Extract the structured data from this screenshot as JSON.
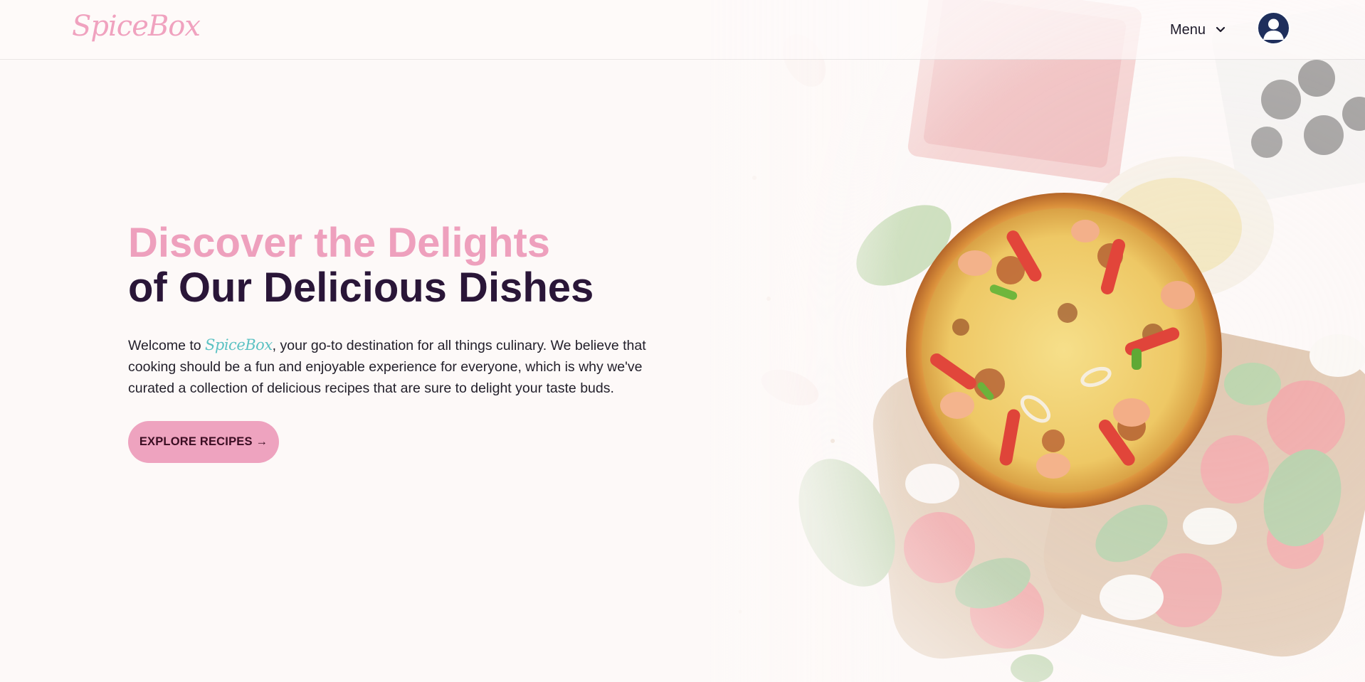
{
  "header": {
    "logo_text": "SpiceBox",
    "menu_label": "Menu",
    "menu_icon": "chevron-down-icon",
    "avatar_icon": "user-account-icon"
  },
  "hero": {
    "headline_line1": "Discover the Delights",
    "headline_line2": "of Our Delicious Dishes",
    "intro_before": "Welcome to ",
    "intro_brand": "SpiceBox",
    "intro_after": ", your go-to destination for all things culinary. We believe that cooking should be a fun and enjoyable experience for everyone, which is why we've curated a collection of delicious recipes that are sure to delight your taste buds.",
    "cta_label": "EXPLORE RECIPES →"
  },
  "colors": {
    "brand_pink": "#eea0bd",
    "heading_dark": "#2a1638",
    "brand_teal": "#5cc2c3",
    "avatar_navy": "#1f2f5c",
    "page_background": "#fdf9f8"
  }
}
